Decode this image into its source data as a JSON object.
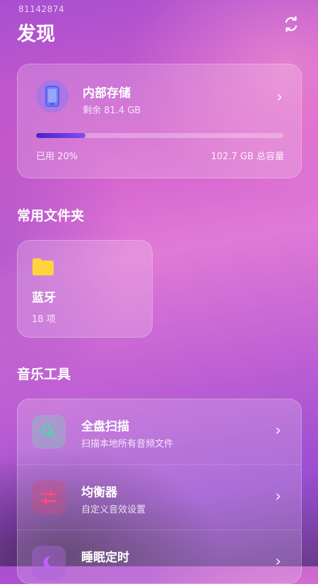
{
  "status": {
    "id_text": "81142874"
  },
  "header": {
    "title": "发现",
    "refresh_icon": "refresh-icon"
  },
  "storage": {
    "title": "内部存储",
    "remaining": "剩余 81.4 GB",
    "used": "已用 20%",
    "used_fraction": 0.2,
    "total": "102.7 GB 总容量",
    "icon": "phone-icon",
    "accent": "#5a2fd8"
  },
  "folders": {
    "section_title": "常用文件夹",
    "items": [
      {
        "name": "蓝牙",
        "count": "18 项",
        "icon": "folder-icon",
        "color": "#ffd43b"
      }
    ]
  },
  "tools": {
    "section_title": "音乐工具",
    "items": [
      {
        "title": "全盘扫描",
        "subtitle": "扫描本地所有音频文件",
        "icon": "search-icon",
        "color": "#3ee0a0"
      },
      {
        "title": "均衡器",
        "subtitle": "自定义音效设置",
        "icon": "equalizer-icon",
        "color": "#ff4d7a"
      },
      {
        "title": "睡眠定时",
        "subtitle": "",
        "icon": "moon-icon",
        "color": "#c060ff"
      }
    ]
  }
}
